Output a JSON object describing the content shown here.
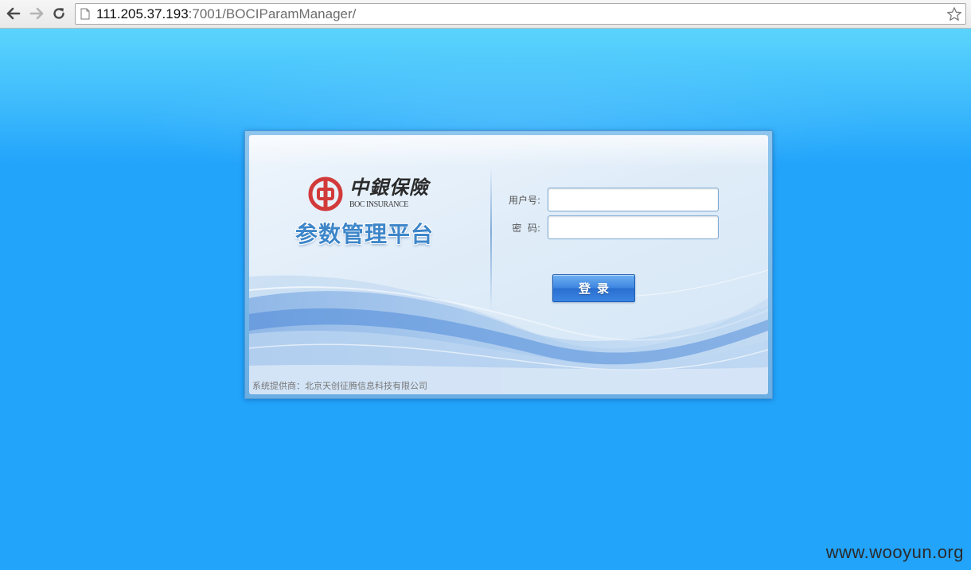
{
  "browser": {
    "url_host": "111.205.37.193",
    "url_path": ":7001/BOCIParamManager/",
    "icons": [
      "back-arrow-icon",
      "forward-arrow-icon",
      "reload-icon",
      "page-icon",
      "star-icon"
    ]
  },
  "brand": {
    "logo_cn": "中銀保險",
    "logo_en": "BOC INSURANCE",
    "platform_title": "参数管理平台",
    "logo_color": "#d23a3a",
    "title_color": "#3e86c9"
  },
  "login_form": {
    "username_label": "用户号:",
    "username_value": "",
    "password_label": "密  码:",
    "password_value": "",
    "submit_label": "登录"
  },
  "footer": {
    "provider_text": "系统提供商：北京天创征腾信息科技有限公司"
  },
  "watermark": "www.wooyun.org",
  "colors": {
    "page_background": "#22a4fb",
    "button": "#3e86e0",
    "panel": "#dfecf8"
  }
}
